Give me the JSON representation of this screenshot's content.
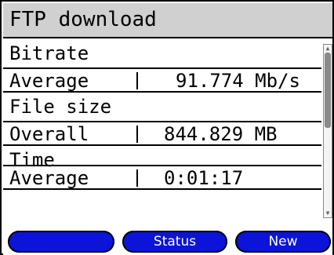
{
  "window": {
    "title": "FTP download"
  },
  "sections": [
    {
      "heading": "Bitrate",
      "row_label": "Average",
      "row_value": "91.774 Mb/s"
    },
    {
      "heading": "File size",
      "row_label": "Overall",
      "row_value": "844.829 MB"
    },
    {
      "heading": "Time",
      "row_label": "Average",
      "row_value": "0:01:17"
    }
  ],
  "scrollbar": {
    "up_arrow": "▲",
    "down_arrow": "▼"
  },
  "softkeys": [
    {
      "label": ""
    },
    {
      "label": "Status"
    },
    {
      "label": "New"
    }
  ],
  "colors": {
    "softkey_bg": "#0b14d8",
    "titlebar_bg": "#d0d0d0"
  }
}
